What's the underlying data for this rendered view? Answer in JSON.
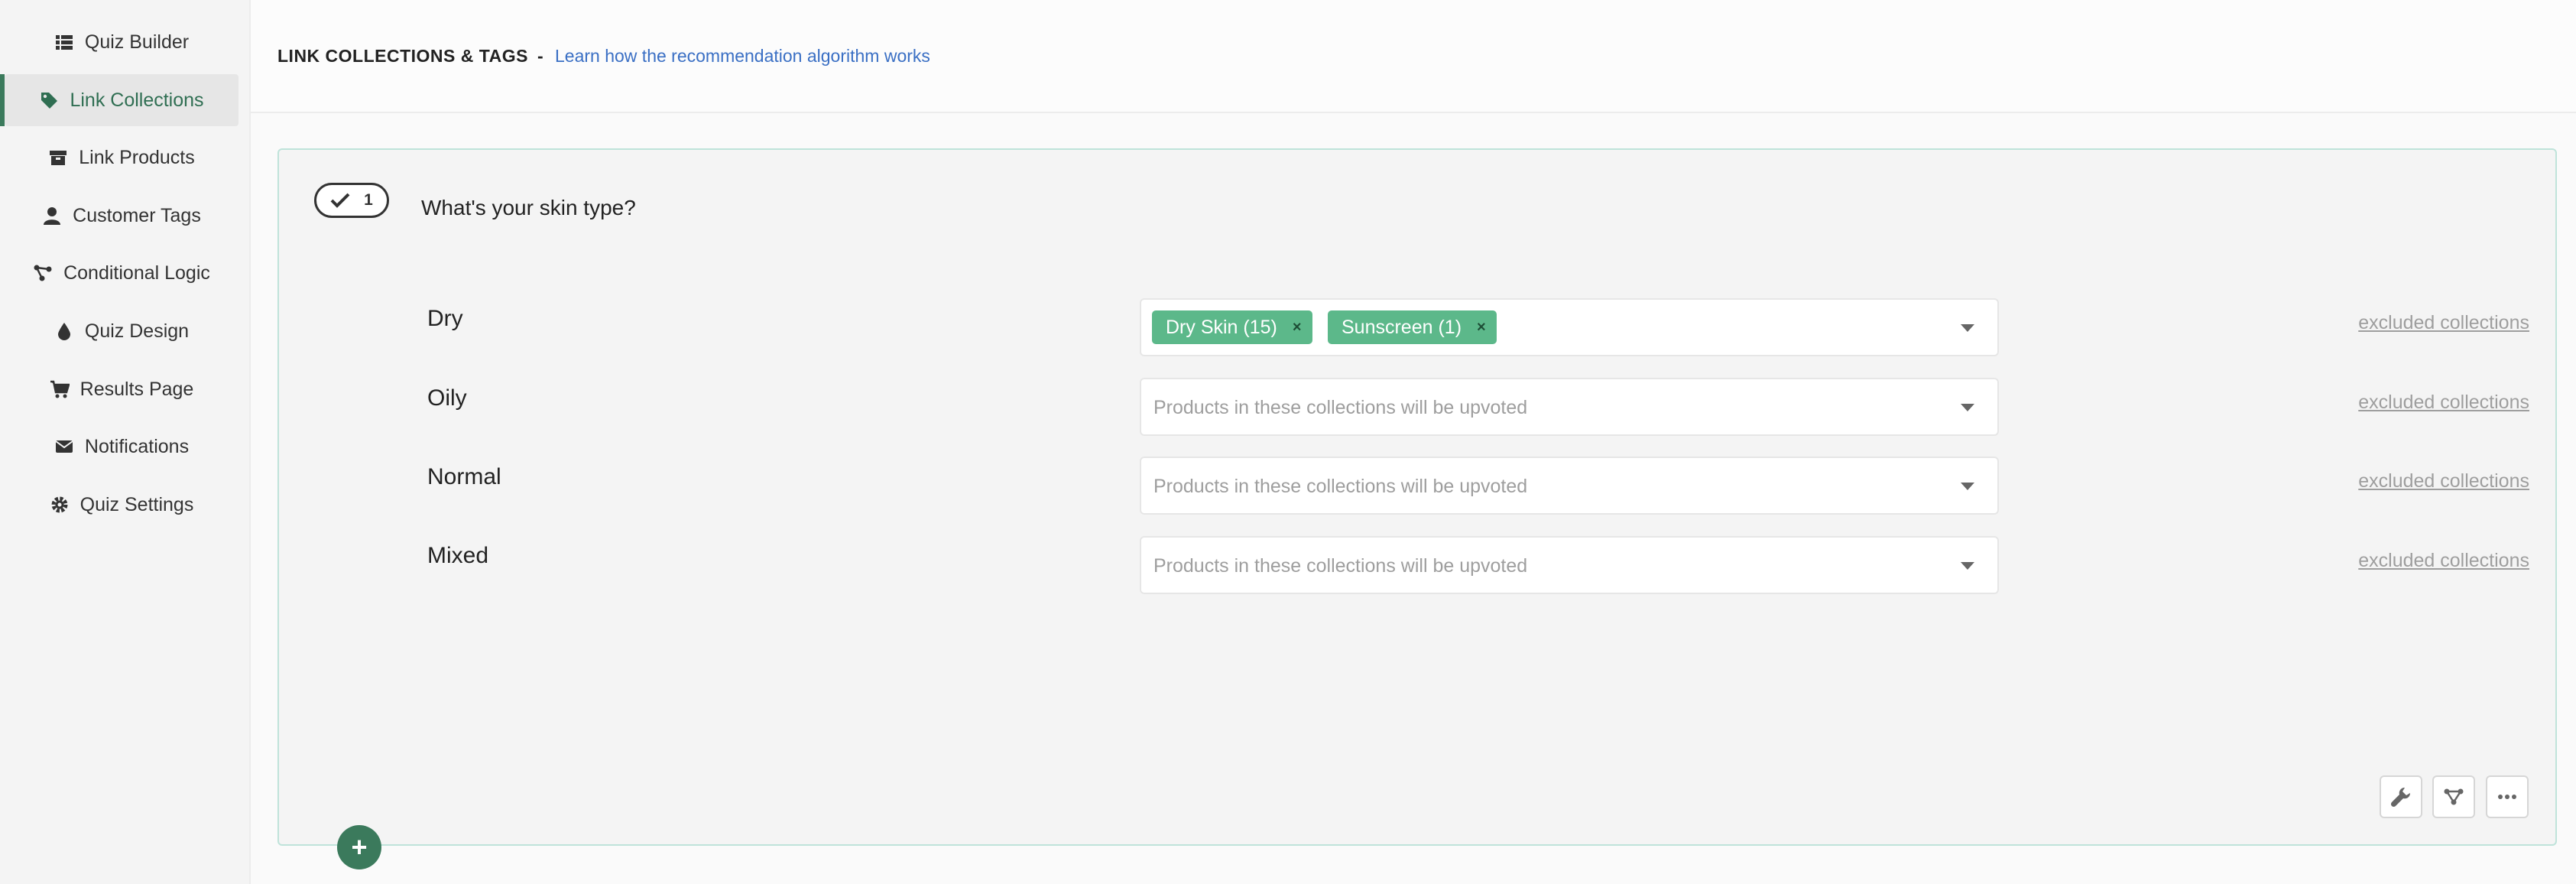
{
  "sidebar": {
    "items": [
      {
        "label": "Quiz Builder",
        "icon": "list-icon"
      },
      {
        "label": "Link Collections",
        "icon": "tag-icon",
        "active": true
      },
      {
        "label": "Link Products",
        "icon": "box-icon"
      },
      {
        "label": "Customer Tags",
        "icon": "user-icon"
      },
      {
        "label": "Conditional Logic",
        "icon": "branch-icon"
      },
      {
        "label": "Quiz Design",
        "icon": "droplet-icon"
      },
      {
        "label": "Results Page",
        "icon": "cart-icon"
      },
      {
        "label": "Notifications",
        "icon": "envelope-icon"
      },
      {
        "label": "Quiz Settings",
        "icon": "gear-icon"
      }
    ]
  },
  "header": {
    "title": "LINK COLLECTIONS & TAGS",
    "separator": "-",
    "help_link": "Learn how the recommendation algorithm works"
  },
  "question": {
    "number": "1",
    "text": "What's your skin type?",
    "answers": [
      {
        "label": "Dry",
        "tags": [
          {
            "label": "Dry Skin (15)",
            "remove": "×"
          },
          {
            "label": "Sunscreen (1)",
            "remove": "×"
          }
        ],
        "placeholder": "",
        "excluded_link": "excluded collections"
      },
      {
        "label": "Oily",
        "tags": [],
        "placeholder": "Products in these collections will be upvoted",
        "excluded_link": "excluded collections"
      },
      {
        "label": "Normal",
        "tags": [],
        "placeholder": "Products in these collections will be upvoted",
        "excluded_link": "excluded collections"
      },
      {
        "label": "Mixed",
        "tags": [],
        "placeholder": "Products in these collections will be upvoted",
        "excluded_link": "excluded collections"
      }
    ]
  },
  "toolbar": {
    "icons": [
      "wrench-icon",
      "branch-icon",
      "more-icon"
    ]
  },
  "add_button": "+",
  "colors": {
    "accent": "#3b7a5c",
    "tag": "#5cb88a",
    "link": "#3a6fc4",
    "card_border": "#bfe3da"
  }
}
